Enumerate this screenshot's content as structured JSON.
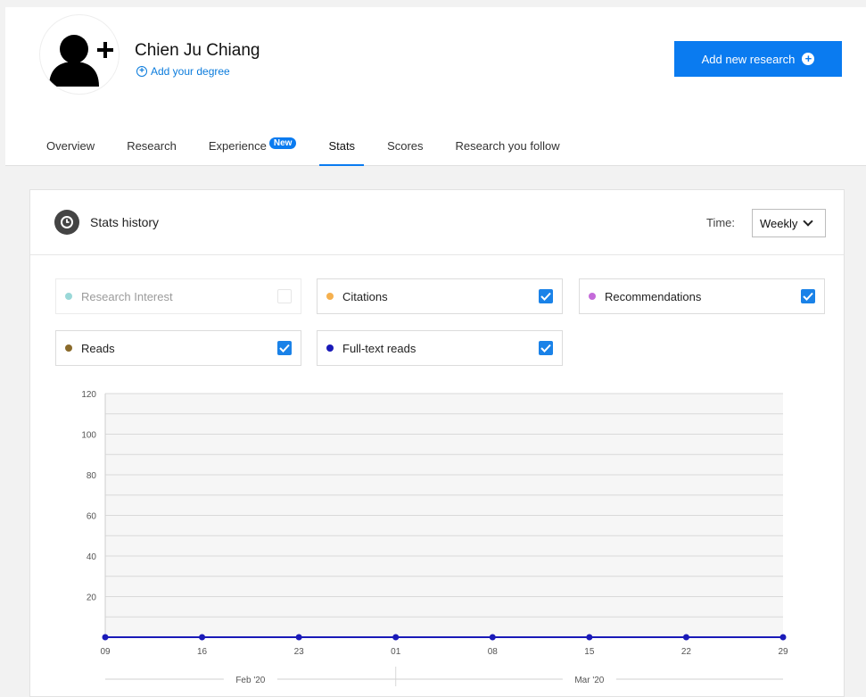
{
  "profile": {
    "name": "Chien Ju Chiang",
    "add_degree_label": "Add your degree",
    "avatar_icon": "add-user-icon"
  },
  "actions": {
    "add_research_label": "Add new research"
  },
  "tabs": [
    {
      "label": "Overview",
      "active": false
    },
    {
      "label": "Research",
      "active": false
    },
    {
      "label": "Experience",
      "badge": "New",
      "active": false
    },
    {
      "label": "Stats",
      "active": true
    },
    {
      "label": "Scores",
      "active": false
    },
    {
      "label": "Research you follow",
      "active": false
    }
  ],
  "stats_panel": {
    "title": "Stats history",
    "time_label": "Time:",
    "time_value": "Weekly",
    "series_toggles": [
      {
        "label": "Research Interest",
        "color": "#9ad8d8",
        "checked": false,
        "enabled": false
      },
      {
        "label": "Citations",
        "color": "#f5b04e",
        "checked": true,
        "enabled": true
      },
      {
        "label": "Recommendations",
        "color": "#c46ad9",
        "checked": true,
        "enabled": true
      },
      {
        "label": "Reads",
        "color": "#8a6a2a",
        "checked": true,
        "enabled": true
      },
      {
        "label": "Full-text reads",
        "color": "#1a1ab8",
        "checked": true,
        "enabled": true
      }
    ]
  },
  "colors": {
    "accent": "#0a7bf0",
    "series_line": "#1a1ab8"
  },
  "chart_data": {
    "type": "line",
    "x": [
      "09",
      "16",
      "23",
      "01",
      "08",
      "15",
      "22",
      "29"
    ],
    "x_groups": [
      {
        "label": "Feb '20",
        "span": [
          0,
          3
        ]
      },
      {
        "label": "Mar '20",
        "span": [
          3,
          7
        ]
      }
    ],
    "yticks": [
      20,
      40,
      60,
      80,
      100,
      120
    ],
    "ylim": [
      0,
      120
    ],
    "series": [
      {
        "color": "#1a1ab8",
        "values": [
          0,
          0,
          0,
          0,
          0,
          0,
          0,
          0
        ]
      }
    ],
    "grid": true
  }
}
